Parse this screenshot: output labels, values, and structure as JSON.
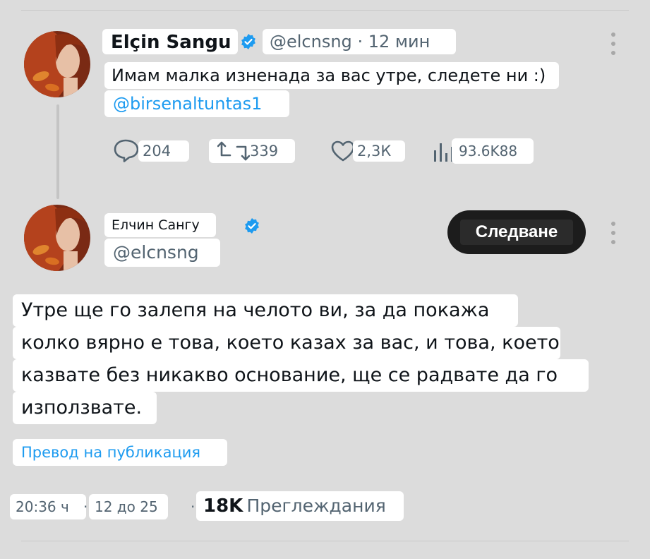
{
  "parent": {
    "display_name": "Elçin Sangu",
    "handle": "@elcnsng",
    "time": "· 12 мин",
    "text": "Имам малка изненада за вас утре, следете ни :)",
    "mention": "@birsenaltuntas1",
    "actions": {
      "replies": "204",
      "retweets": "339",
      "likes": "2,3К",
      "views": "93.6K88"
    },
    "icons": [
      "comment-icon",
      "retweet-icon",
      "heart-icon",
      "views-icon",
      "more-icon",
      "verified-icon"
    ]
  },
  "reply": {
    "display_name": "Елчин Сангу",
    "handle": "@elcnsng",
    "follow_label": "Следване",
    "text_lines": [
      "Утре ще го залепя на челото ви, за да покажа",
      "колко вярно е това, което казах за вас, и това, което",
      "казвате без никакво основание, ще се радвате да го",
      "използвате."
    ],
    "translate_label": "Превод на публикация",
    "time": "20:36 ч",
    "date": "12 до 25",
    "views_count": "18K",
    "views_label": "Преглеждания"
  },
  "colors": {
    "background": "#dcdcdc",
    "link": "#1d9bf0",
    "verified": "#1d9bf0",
    "muted": "#536471",
    "follow_button": "#1c1c1c"
  }
}
